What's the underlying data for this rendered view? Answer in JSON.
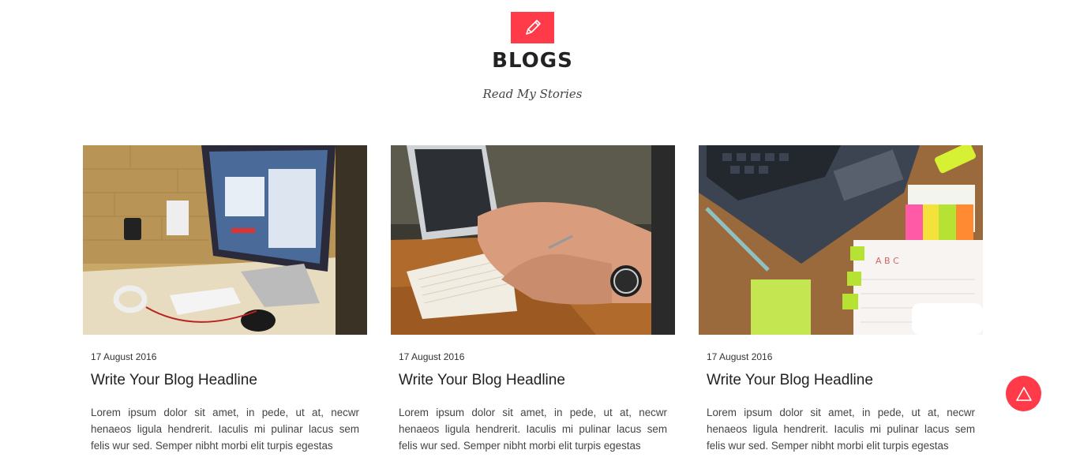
{
  "section": {
    "icon": "pencil-icon",
    "title": "BLOGS",
    "subtitle": "Read My Stories",
    "accent_color": "#ff3b4a"
  },
  "posts": [
    {
      "image": "desk-computer-photo",
      "date": "17 August 2016",
      "headline": "Write Your Blog Headline",
      "excerpt": "Lorem ipsum dolor sit amet, in pede, ut at, necwr henaeos ligula hendrerit. Iaculis mi pulinar lacus sem felis wur sed. Semper nibht morbi elit turpis egestas"
    },
    {
      "image": "writing-notebook-photo",
      "date": "17 August 2016",
      "headline": "Write Your Blog Headline",
      "excerpt": "Lorem ipsum dolor sit amet, in pede, ut at, necwr henaeos ligula hendrerit. Iaculis mi pulinar lacus sem felis wur sed. Semper nibht morbi elit turpis egestas"
    },
    {
      "image": "laptop-sticky-notes-photo",
      "date": "17 August 2016",
      "headline": "Write Your Blog Headline",
      "excerpt": "Lorem ipsum dolor sit amet, in pede, ut at, necwr henaeos ligula hendrerit. Iaculis mi pulinar lacus sem felis wur sed. Semper nibht morbi elit turpis egestas"
    }
  ],
  "scroll_top": {
    "icon": "triangle-up-icon"
  }
}
